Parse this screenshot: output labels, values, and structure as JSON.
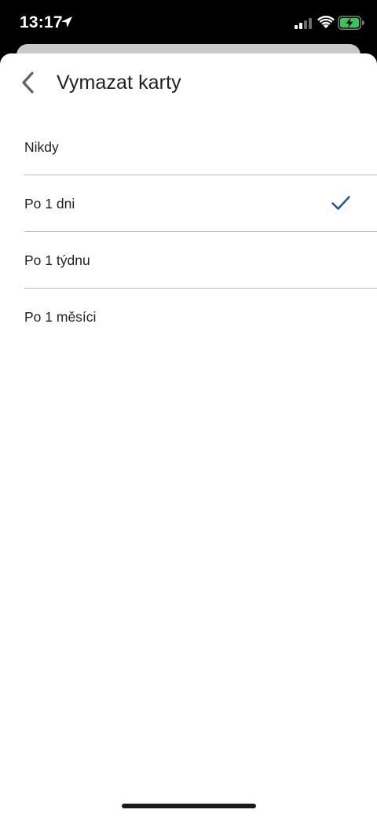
{
  "status_bar": {
    "time": "13:17"
  },
  "header": {
    "title": "Vymazat karty",
    "back_icon": "chevron-left-icon"
  },
  "options": [
    {
      "label": "Nikdy",
      "selected": false
    },
    {
      "label": "Po 1 dni",
      "selected": true
    },
    {
      "label": "Po 1 týdnu",
      "selected": false
    },
    {
      "label": "Po 1 měsíci",
      "selected": false
    }
  ],
  "colors": {
    "accent": "#1a4f99",
    "text": "#202124",
    "divider": "#bdbdbd",
    "status_bar_bg": "#000000",
    "battery_fill": "#34c759"
  }
}
